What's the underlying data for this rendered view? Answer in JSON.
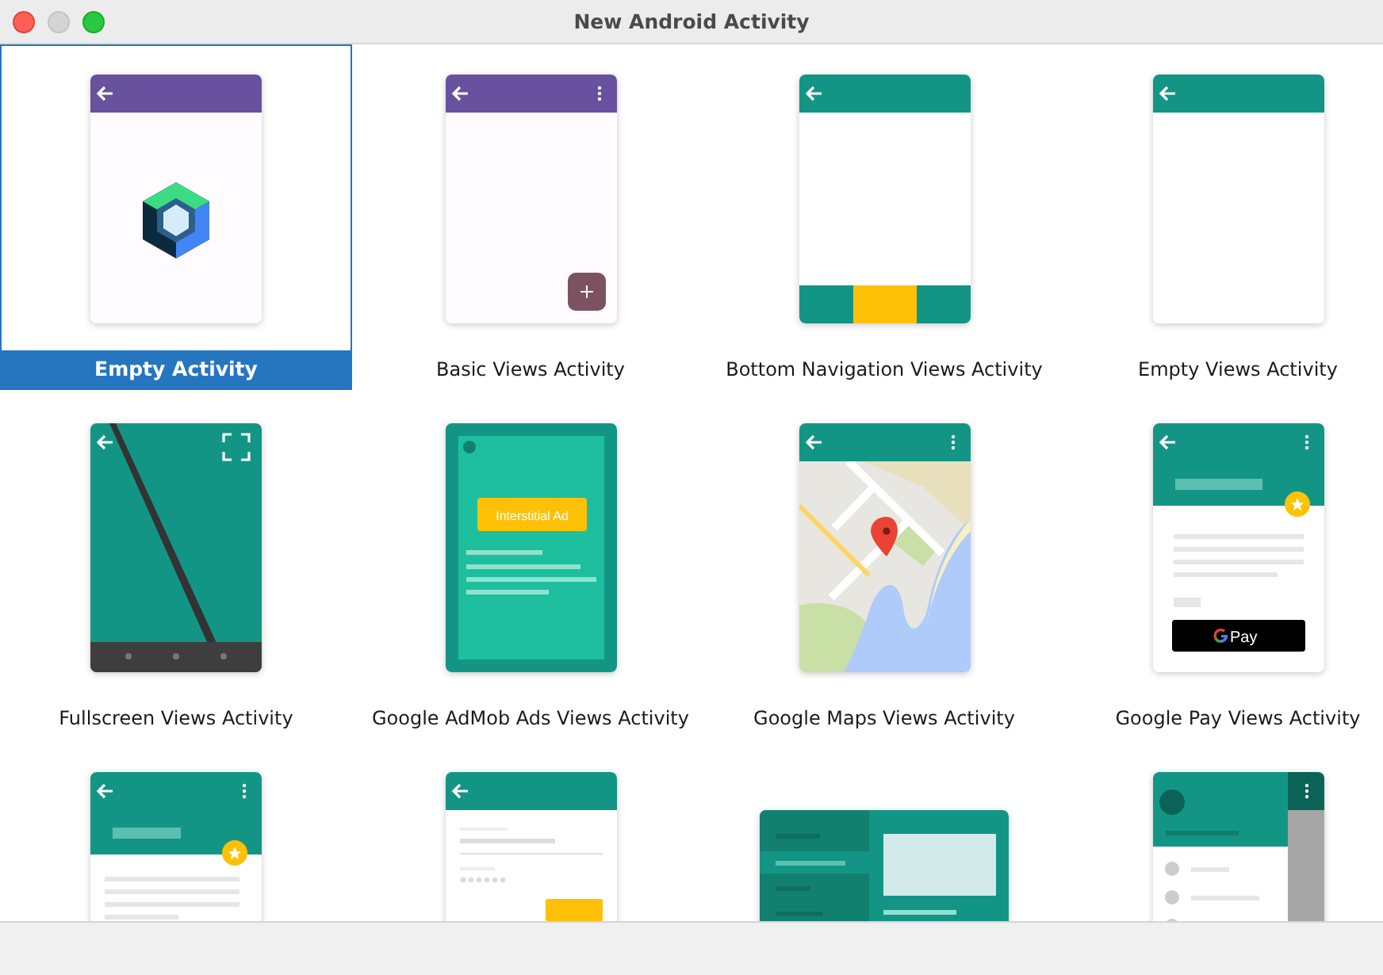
{
  "window": {
    "title": "New Android Activity"
  },
  "templates": [
    {
      "label": "Empty Activity",
      "selected": true,
      "kind": "compose"
    },
    {
      "label": "Basic Views Activity",
      "selected": false,
      "kind": "basic"
    },
    {
      "label": "Bottom Navigation Views Activity",
      "selected": false,
      "kind": "bottomnav"
    },
    {
      "label": "Empty Views Activity",
      "selected": false,
      "kind": "empty"
    },
    {
      "label": "Fullscreen Views Activity",
      "selected": false,
      "kind": "fullscreen"
    },
    {
      "label": "Google AdMob Ads Views Activity",
      "selected": false,
      "kind": "admob",
      "ad_text": "Interstitial Ad"
    },
    {
      "label": "Google Maps Views Activity",
      "selected": false,
      "kind": "maps"
    },
    {
      "label": "Google Pay Views Activity",
      "selected": false,
      "kind": "pay",
      "button_text": "Pay"
    },
    {
      "selected": false,
      "kind": "scrolling"
    },
    {
      "selected": false,
      "kind": "login"
    },
    {
      "selected": false,
      "kind": "masterdetail"
    },
    {
      "selected": false,
      "kind": "drawer"
    }
  ]
}
